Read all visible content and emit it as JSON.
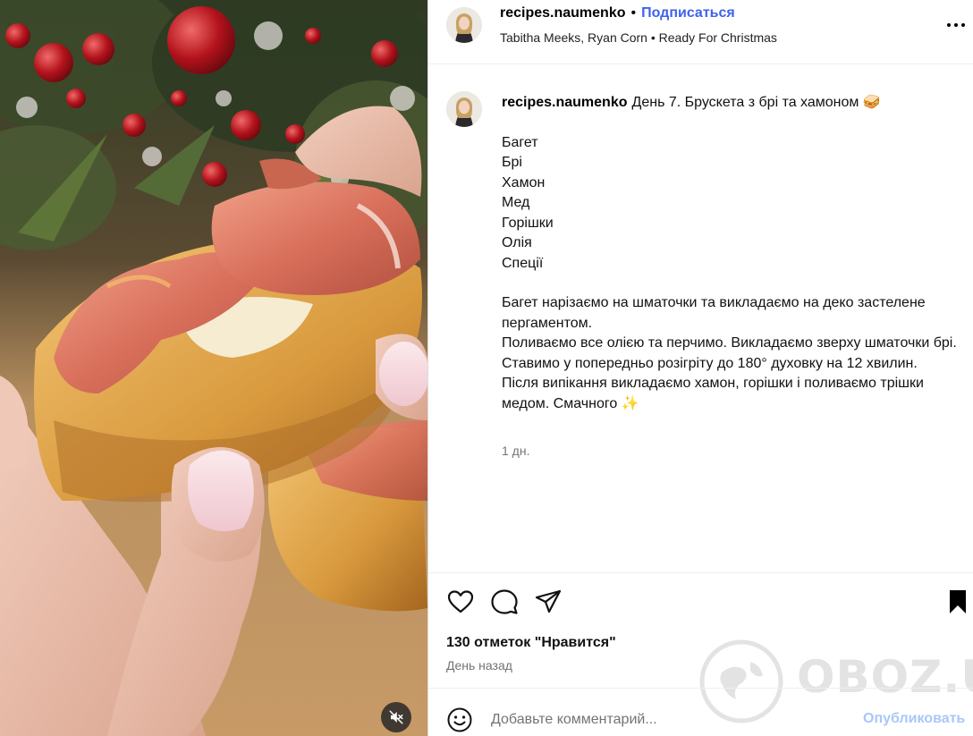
{
  "media": {
    "image_desc_icon": "video-frame",
    "mute_icon": "speaker-muted-icon"
  },
  "header": {
    "username": "recipes.naumenko",
    "separator": "•",
    "follow_label": "Подписаться",
    "audio_artists": "Tabitha Meeks, Ryan Corn",
    "audio_separator": "•",
    "audio_title": "Ready For Christmas",
    "more_icon": "ellipsis-icon"
  },
  "caption": {
    "username": "recipes.naumenko",
    "title": "День 7. Брускета з брі та хамоном 🥪",
    "ingredients": [
      "Багет",
      "Брі",
      "Хамон",
      "Мед",
      "Горішки",
      "Олія",
      "Спеції"
    ],
    "steps": [
      "Багет нарізаємо на шматочки та викладаємо на деко застелене пергаментом.",
      "Поливаємо все олією та перчимо. Викладаємо зверху шматочки брі.",
      "Ставимо у попередньо розігріту до 180° духовку на 12 хвилин.",
      "Після випікання викладаємо хамон, горішки і поливаємо трішки медом. Смачного ✨"
    ],
    "time": "1 дн."
  },
  "actions": {
    "like_icon": "heart-icon",
    "comment_icon": "comment-icon",
    "share_icon": "paper-plane-icon",
    "save_icon": "bookmark-icon",
    "likes_text": "130 отметок \"Нравится\"",
    "date_text": "День назад"
  },
  "comment": {
    "emoji_icon": "smiley-icon",
    "placeholder": "Добавьте комментарий...",
    "publish_label": "Опубликовать"
  },
  "watermark": {
    "text": "OBOZ.UA"
  },
  "colors": {
    "accent": "#3f62ee",
    "publish_disabled": "#a8c7fa",
    "muted_text": "#737373"
  }
}
